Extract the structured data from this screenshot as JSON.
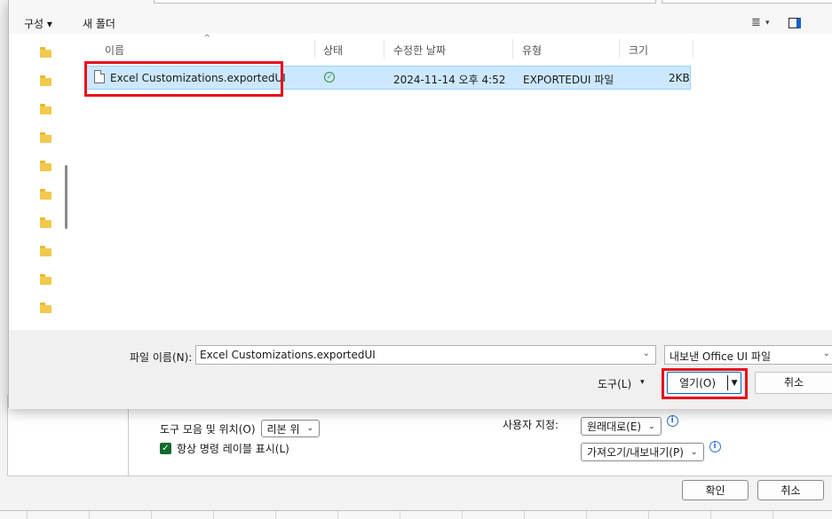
{
  "toolbar": {
    "organize_label": "구성 ▾",
    "new_folder_label": "새 폴더"
  },
  "columns": {
    "name": "이름",
    "status": "상태",
    "date": "수정한 날짜",
    "type": "유형",
    "size": "크기"
  },
  "file": {
    "name": "Excel Customizations.exportedUI",
    "date": "2024-11-14 오후 4:52",
    "type": "EXPORTEDUI 파일",
    "size": "2KB"
  },
  "footer": {
    "filename_label": "파일 이름(N):",
    "filename_value": "Excel Customizations.exportedUI",
    "filetype_value": "내보낸 Office UI 파일",
    "tools_label": "도구(L)",
    "open_label": "열기(O)",
    "cancel_label": "취소"
  },
  "background": {
    "toolbar_position_label": "도구 모음 및 위치(O)",
    "ribbon_select_value": "리본 위",
    "show_labels_label": "항상 명령 레이블 표시(L)",
    "customize_label": "사용자 지정:",
    "reset_label": "원래대로(E)",
    "import_export_label": "가져오기/내보내기(P)",
    "ok_label": "확인",
    "cancel_label": "취소"
  },
  "colors": {
    "selection_bg": "#cce8ff",
    "highlight_red": "#e8101a",
    "accent_blue": "#1a63c4"
  }
}
